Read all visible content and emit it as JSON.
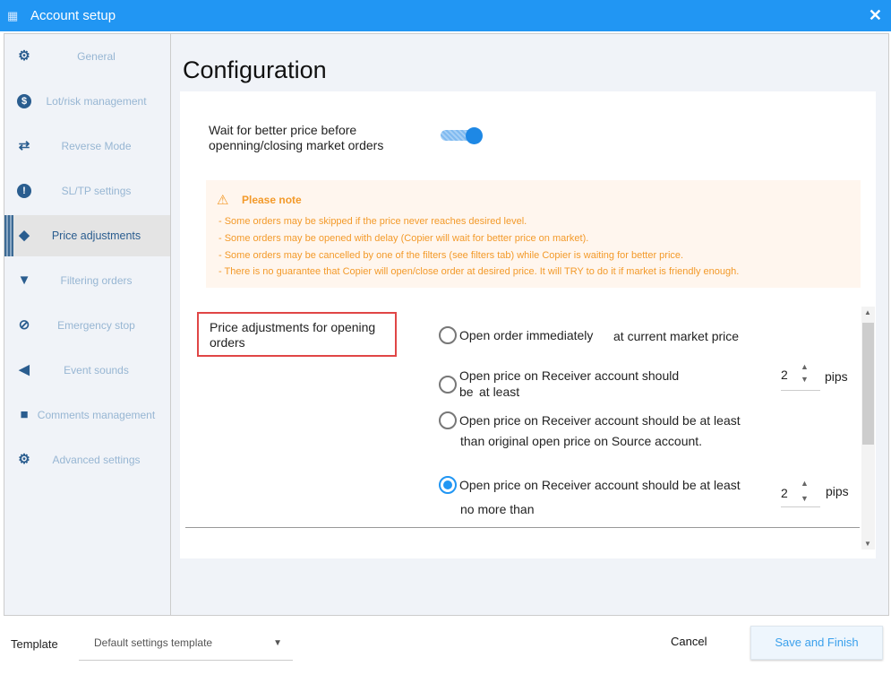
{
  "window": {
    "title": "Account setup",
    "logo_icon": "copier-logo-icon",
    "close_icon": "close-icon"
  },
  "sidebar": {
    "active_index": 4,
    "items": [
      {
        "label": "General",
        "icon": "gear-icon"
      },
      {
        "label": "Lot/risk management",
        "icon": "dollar-icon"
      },
      {
        "label": "Reverse Mode",
        "icon": "reverse-arrows-icon"
      },
      {
        "label": "SL/TP settings",
        "icon": "exclamation-icon"
      },
      {
        "label": "Price adjustments",
        "icon": "tag-icon"
      },
      {
        "label": "Filtering orders",
        "icon": "filter-icon"
      },
      {
        "label": "Emergency stop",
        "icon": "ban-icon"
      },
      {
        "label": "Event sounds",
        "icon": "speaker-icon"
      },
      {
        "label": "Comments management",
        "icon": "comment-icon"
      },
      {
        "label": "Advanced settings",
        "icon": "gears-icon"
      }
    ]
  },
  "main": {
    "title": "Configuration",
    "wait_toggle": {
      "label_line1": "Wait for better price before",
      "label_line2": "openning/closing market orders",
      "on": true
    },
    "note": {
      "title": "Please note",
      "icon": "warning-icon",
      "lines": [
        "- Some orders may be skipped if the price never reaches desired level.",
        "- Some orders may be opened with delay (Copier will wait for better price on market).",
        "- Some orders may be cancelled by one of the filters (see filters tab) while Copier is waiting for better price.",
        "- There is no guarantee that Copier will open/close order at desired price. It will TRY to do it if market is friendly enough."
      ]
    },
    "price_adjustments": {
      "label": "Price adjustments for opening orders",
      "selected_index": 3,
      "options": [
        {
          "text1": "Open order immediately",
          "text2": "at current market price"
        },
        {
          "text1": "Open price on Receiver account should",
          "text2": "be",
          "text3": "at least",
          "value": "2",
          "unit": "pips"
        },
        {
          "text1": "Open price on Receiver account should be at least",
          "text2": "than original open price on Source account."
        },
        {
          "text1": "Open price on Receiver account should be at least",
          "text2": "no more than",
          "value": "2",
          "unit": "pips"
        }
      ]
    },
    "scrollbar_position_percent": 35
  },
  "footer": {
    "template_label": "Template",
    "template_value": "Default settings template",
    "cancel_label": "Cancel",
    "save_label": "Save and Finish"
  },
  "colors": {
    "accent": "#2196f3",
    "note_text": "#f39a2a",
    "note_bg": "#fff6ee",
    "highlight_border": "#e04646"
  }
}
